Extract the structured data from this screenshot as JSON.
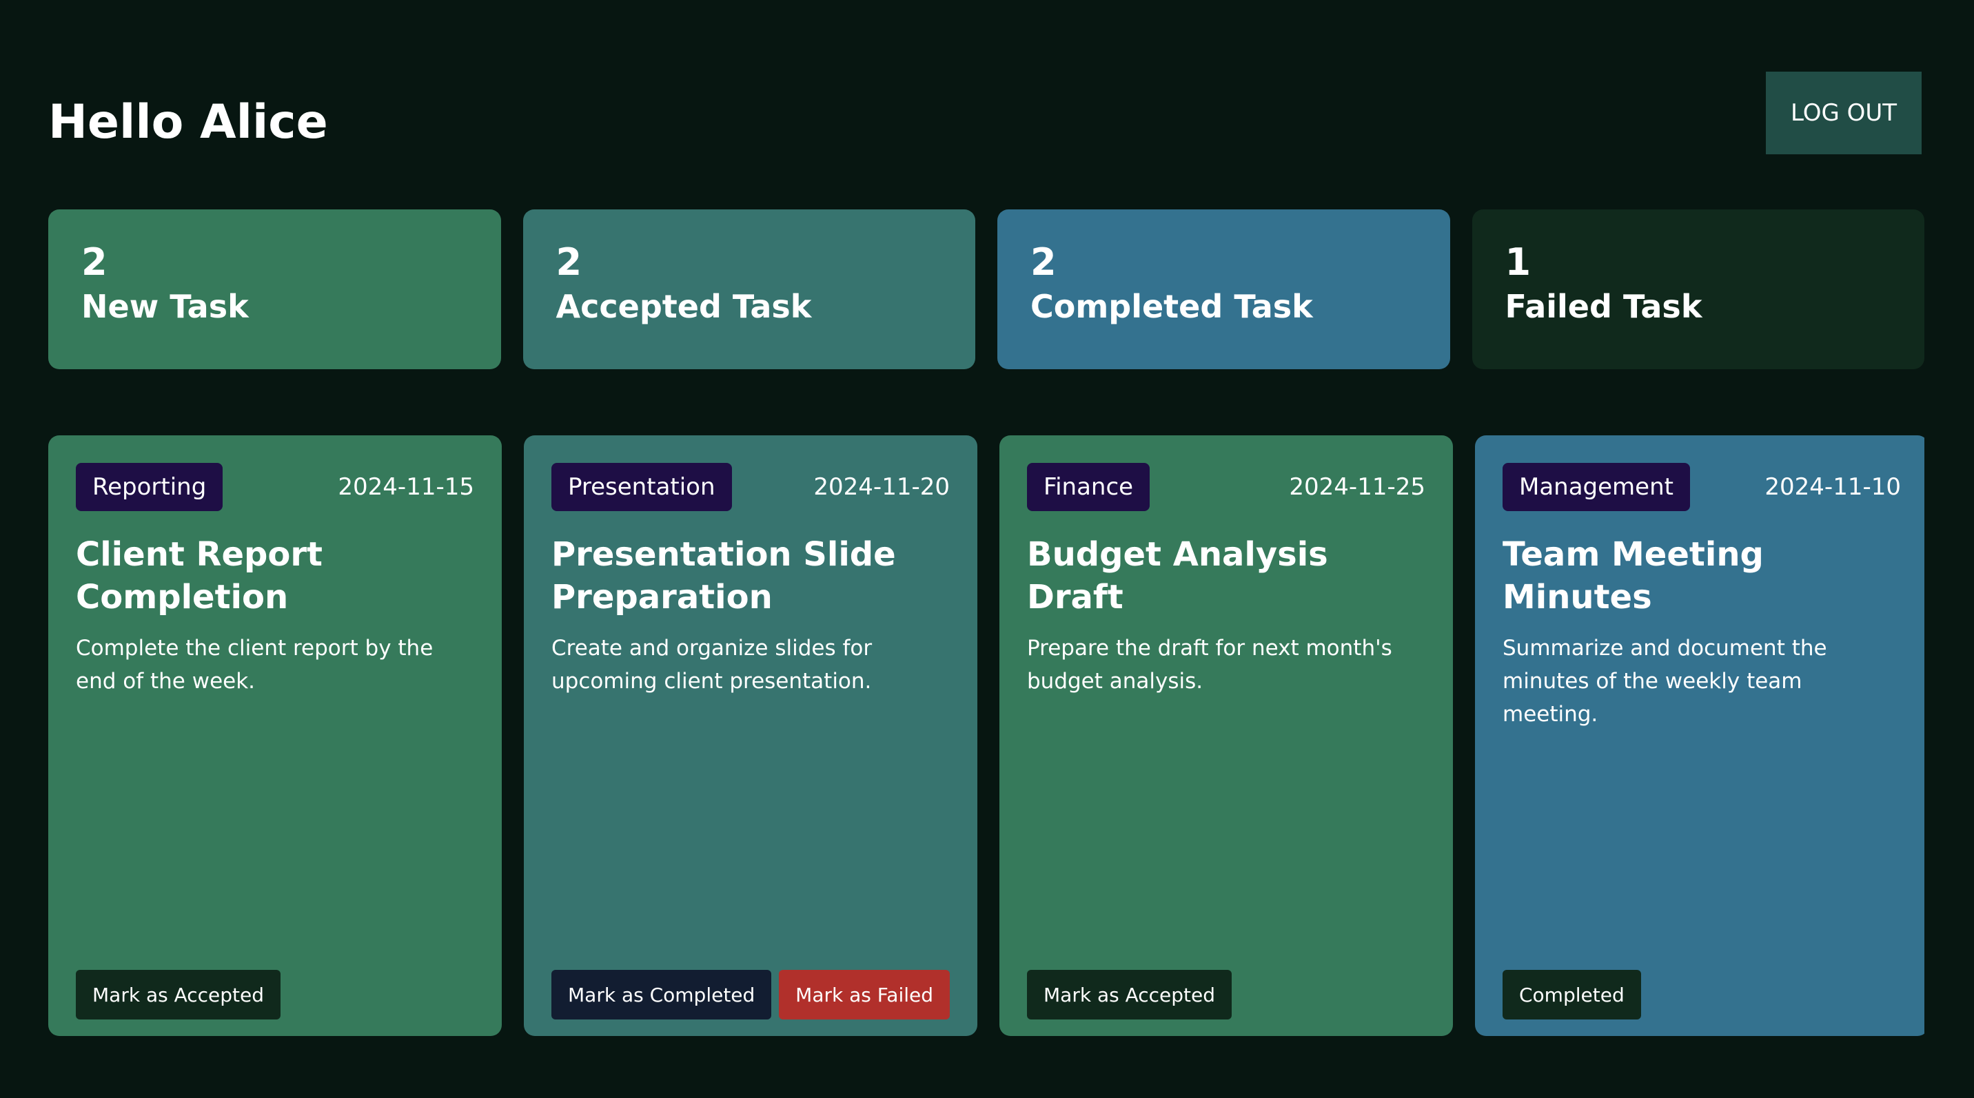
{
  "header": {
    "greeting": "Hello Alice",
    "logout_label": "LOG OUT"
  },
  "stats": [
    {
      "count": "2",
      "label": "New Task",
      "color": "#367a5b"
    },
    {
      "count": "2",
      "label": "Accepted Task",
      "color": "#37746f"
    },
    {
      "count": "2",
      "label": "Completed Task",
      "color": "#34728f"
    },
    {
      "count": "1",
      "label": "Failed Task",
      "color": "#10291c"
    }
  ],
  "tasks": [
    {
      "category": "Reporting",
      "date": "2024-11-15",
      "title": "Client Report Completion",
      "description": "Complete the client report by the end of the week.",
      "color": "#367a5b",
      "actions": [
        {
          "label": "Mark as Accepted",
          "color": "#10291c"
        }
      ]
    },
    {
      "category": "Presentation",
      "date": "2024-11-20",
      "title": "Presentation Slide Preparation",
      "description": "Create and organize slides for upcoming client presentation.",
      "color": "#37746f",
      "actions": [
        {
          "label": "Mark as Completed",
          "color": "#121d31"
        },
        {
          "label": "Mark as Failed",
          "color": "#b1302b"
        }
      ]
    },
    {
      "category": "Finance",
      "date": "2024-11-25",
      "title": "Budget Analysis Draft",
      "description": "Prepare the draft for next month's budget analysis.",
      "color": "#367a5b",
      "actions": [
        {
          "label": "Mark as Accepted",
          "color": "#10291c"
        }
      ]
    },
    {
      "category": "Management",
      "date": "2024-11-10",
      "title": "Team Meeting Minutes",
      "description": "Summarize and document the minutes of the weekly team meeting.",
      "color": "#34728f",
      "actions": [
        {
          "label": "Completed",
          "color": "#10291c"
        }
      ]
    }
  ]
}
